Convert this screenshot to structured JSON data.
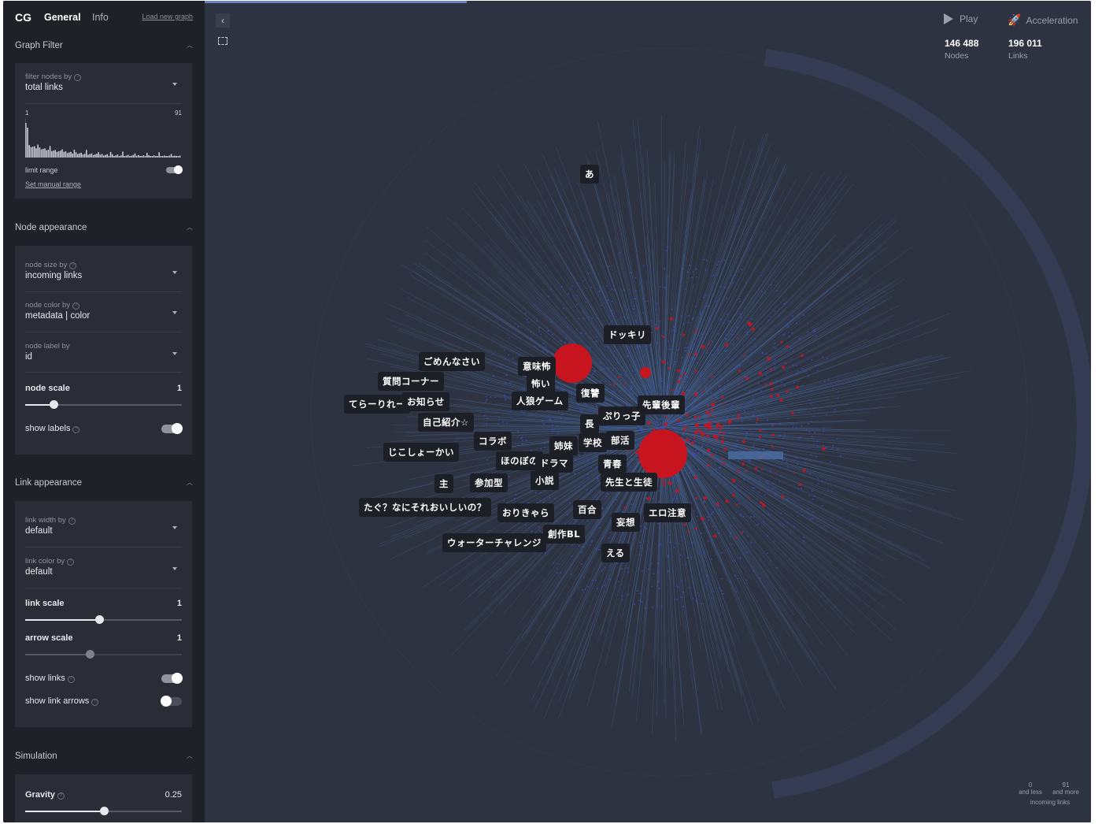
{
  "header": {
    "logo": "CG",
    "tab_general": "General",
    "tab_info": "Info",
    "load_link": "Load new graph"
  },
  "graph_filter": {
    "title": "Graph Filter",
    "filter_label": "filter nodes by",
    "filter_value": "total links",
    "hist_min": "1",
    "hist_max": "91",
    "limit_range_label": "limit range",
    "limit_range_on": true,
    "manual_range_link": "Set manual range"
  },
  "node_appearance": {
    "title": "Node appearance",
    "size_label": "node size by",
    "size_value": "incoming links",
    "color_label": "node color by",
    "color_value": "metadata | color",
    "label_label": "node label by",
    "label_value": "id",
    "scale_label": "node scale",
    "scale_value": "1",
    "scale_fraction": 0.18,
    "show_labels_label": "show labels",
    "show_labels_on": true
  },
  "link_appearance": {
    "title": "Link appearance",
    "width_label": "link width by",
    "width_value": "default",
    "color_label": "link color by",
    "color_value": "default",
    "link_scale_label": "link scale",
    "link_scale_value": "1",
    "link_scale_fraction": 0.47,
    "arrow_scale_label": "arrow scale",
    "arrow_scale_value": "1",
    "arrow_scale_fraction": 0.41,
    "show_links_label": "show links",
    "show_links_on": true,
    "show_arrows_label": "show link arrows",
    "show_arrows_on": false
  },
  "simulation": {
    "title": "Simulation",
    "gravity_label": "Gravity",
    "gravity_value": "0.25",
    "gravity_fraction": 0.5
  },
  "top_controls": {
    "play_label": "Play",
    "acceleration_label": "Acceleration",
    "nodes_count": "146 488",
    "nodes_label": "Nodes",
    "links_count": "196 011",
    "links_label": "Links"
  },
  "legend": {
    "min_value": "0",
    "min_caption": "and less",
    "max_value": "91",
    "max_caption": "and more",
    "title": "incoming links"
  },
  "node_labels": [
    "あ",
    "ドッキリ",
    "ごめんなさい",
    "意味怖",
    "質問コーナー",
    "怖い",
    "てらーりれー",
    "お知らせ",
    "人狼ゲーム",
    "復讐",
    "先輩後輩",
    "ぷりっ子",
    "長",
    "自己紹介☆",
    "コラボ",
    "姉妹",
    "学校",
    "部活",
    "じこしょーかい",
    "ほのぼの",
    "ドラマ",
    "青春",
    "主",
    "参加型",
    "小説",
    "先生と生徒",
    "たぐ？なにそれおいしいの？",
    "おりきゃら",
    "百合",
    "妄想",
    "エロ注意",
    "ウォーターチャレンジ",
    "創作BL",
    "える"
  ],
  "colors": {
    "accent_red": "#c8141e",
    "node_blue": "#3a4fd8",
    "link_blue": "#4a6fa8",
    "background": "#2e3341"
  }
}
